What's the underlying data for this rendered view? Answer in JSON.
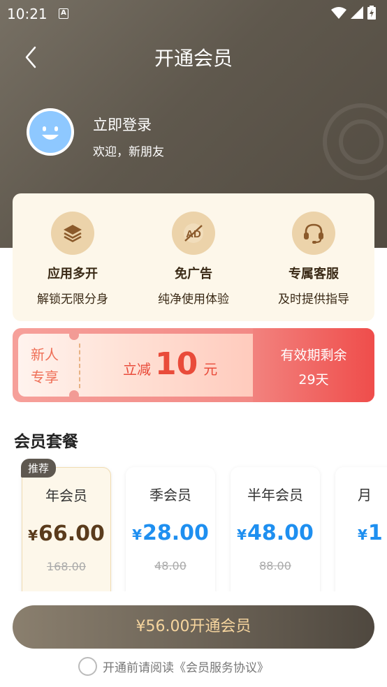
{
  "status_bar": {
    "time": "10:21",
    "badge": "A"
  },
  "nav": {
    "title": "开通会员"
  },
  "user": {
    "login": "立即登录",
    "welcome": "欢迎，新朋友"
  },
  "benefits": [
    {
      "icon": "layers-icon",
      "title": "应用多开",
      "desc": "解锁无限分身"
    },
    {
      "icon": "no-ads-icon",
      "title": "免广告",
      "desc": "纯净使用体验"
    },
    {
      "icon": "headset-icon",
      "title": "专属客服",
      "desc": "及时提供指导"
    }
  ],
  "coupon": {
    "label_line1": "新人",
    "label_line2": "专享",
    "prefix": "立减",
    "amount": "10",
    "unit": "元",
    "validity_label": "有效期剩余",
    "validity_days": "29天"
  },
  "plans_section": {
    "title": "会员套餐"
  },
  "plans": [
    {
      "tag": "推荐",
      "name": "年会员",
      "currency": "¥",
      "price": "66.00",
      "original": "168.00",
      "selected": true
    },
    {
      "tag": "",
      "name": "季会员",
      "currency": "¥",
      "price": "28.00",
      "original": "48.00",
      "selected": false
    },
    {
      "tag": "",
      "name": "半年会员",
      "currency": "¥",
      "price": "48.00",
      "original": "88.00",
      "selected": false
    },
    {
      "tag": "",
      "name": "月",
      "currency": "¥",
      "price": "1",
      "original": "",
      "selected": false
    }
  ],
  "footer": {
    "pay_button": "¥56.00开通会员",
    "agreement": "开通前请阅读《会员服务协议》"
  },
  "colors": {
    "hero": "#5f584d",
    "accent_gold": "#f6d59e",
    "price_blue": "#1e8ff0",
    "coupon_red": "#e94b3a"
  }
}
